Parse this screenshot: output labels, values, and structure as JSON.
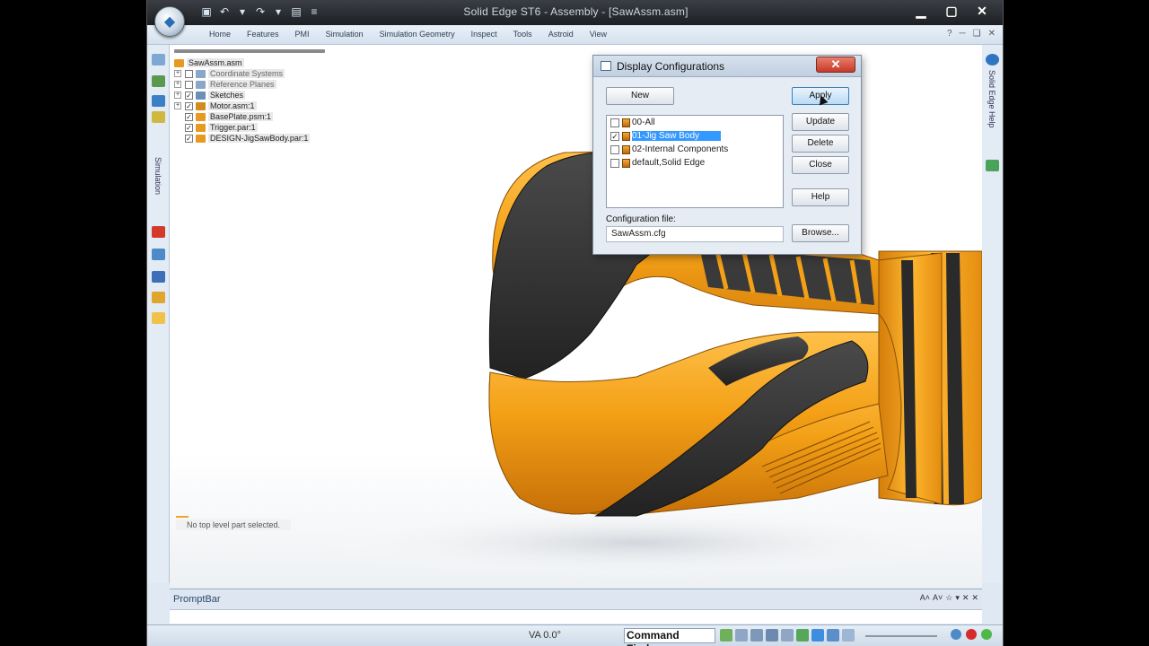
{
  "window": {
    "title": "Solid Edge ST6 - Assembly - [SawAssm.asm]"
  },
  "ribbon": {
    "tabs": [
      "Home",
      "Features",
      "PMI",
      "Simulation",
      "Simulation Geometry",
      "Inspect",
      "Tools",
      "Astroid",
      "View"
    ],
    "right_icons": [
      "?",
      "─",
      "❏",
      "✕"
    ]
  },
  "left_bar": {
    "vertical_label": "Simulation"
  },
  "right_bar": {
    "vertical_label": "Solid Edge Help"
  },
  "tree": {
    "root": "SawAssm.asm",
    "items": [
      {
        "label": "Coordinate Systems",
        "expander": "+",
        "checked": false,
        "icon_color": "#8aa6c8",
        "dim": true
      },
      {
        "label": "Reference Planes",
        "expander": "+",
        "checked": false,
        "icon_color": "#8aa6c8",
        "dim": true
      },
      {
        "label": "Sketches",
        "expander": "+",
        "checked": true,
        "icon_color": "#6a8fb8",
        "dim": false
      },
      {
        "label": "Motor.asm:1",
        "expander": "+",
        "checked": true,
        "icon_color": "#d38a1e",
        "dim": false
      },
      {
        "label": "BasePlate.psm:1",
        "expander": "",
        "checked": true,
        "icon_color": "#e69a22",
        "dim": false
      },
      {
        "label": "Trigger.par:1",
        "expander": "",
        "checked": true,
        "icon_color": "#e69a22",
        "dim": false
      },
      {
        "label": "DESIGN-JigSawBody.par:1",
        "expander": "",
        "checked": true,
        "icon_color": "#e69a22",
        "dim": false
      }
    ],
    "status": "No top level part selected."
  },
  "dialog": {
    "title": "Display Configurations",
    "close_label": "✕",
    "new_label": "New",
    "apply_label": "Apply",
    "update_label": "Update",
    "delete_label": "Delete",
    "close_button_label": "Close",
    "help_label": "Help",
    "browse_label": "Browse...",
    "configurations": [
      {
        "name": "00-All",
        "checked": false,
        "selected": false
      },
      {
        "name": "01-Jig Saw Body",
        "checked": true,
        "selected": true
      },
      {
        "name": "02-Internal Components",
        "checked": false,
        "selected": false
      },
      {
        "name": "default,Solid Edge",
        "checked": false,
        "selected": false
      }
    ],
    "config_file_label": "Configuration file:",
    "config_file_value": "SawAssm.cfg"
  },
  "promptbar": {
    "title": "PromptBar",
    "icons": [
      "A˄",
      "A˅",
      "☆",
      "▾",
      "✕",
      "✕"
    ]
  },
  "statusbar": {
    "view_angle": "VA 0.0°",
    "command_finder": "Command Finder"
  },
  "colors": {
    "body_orange": "#f3a016",
    "grip_dark": "#2b2b2b",
    "selection": "#3399ff"
  }
}
